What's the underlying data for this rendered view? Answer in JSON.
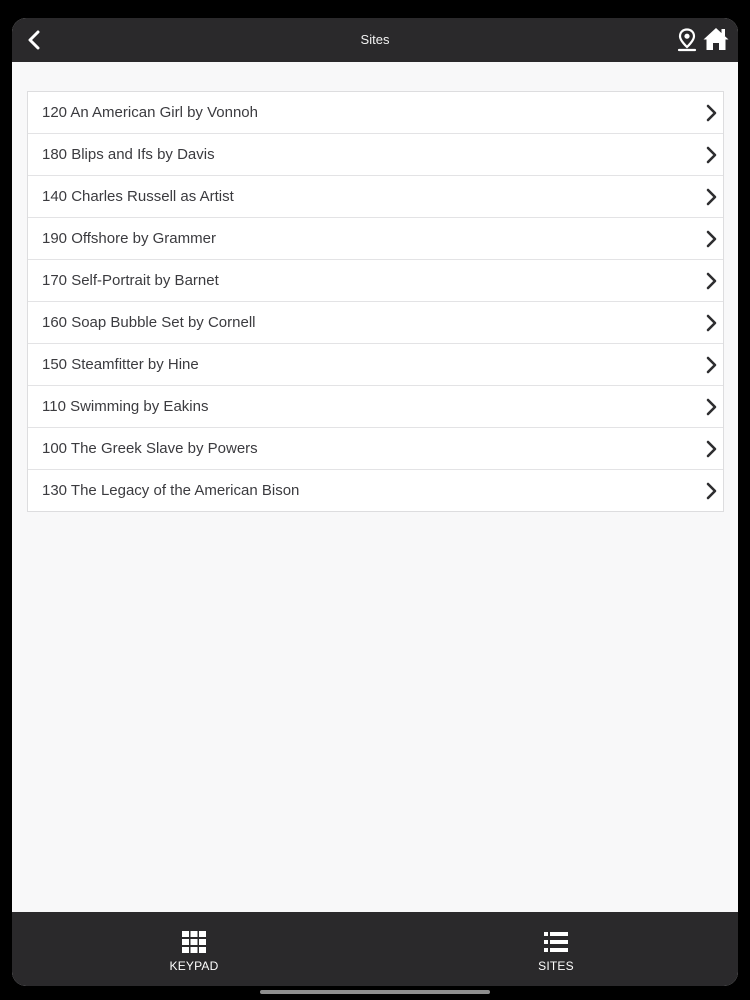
{
  "header": {
    "title": "Sites"
  },
  "sites": [
    {
      "label": "120 An American Girl by Vonnoh"
    },
    {
      "label": "180 Blips and Ifs by Davis"
    },
    {
      "label": "140 Charles Russell as Artist"
    },
    {
      "label": "190 Offshore by Grammer"
    },
    {
      "label": "170 Self-Portrait by Barnet"
    },
    {
      "label": "160 Soap Bubble Set by Cornell"
    },
    {
      "label": "150 Steamfitter by Hine"
    },
    {
      "label": "110 Swimming by Eakins"
    },
    {
      "label": "100 The Greek Slave by Powers"
    },
    {
      "label": "130 The Legacy of the American Bison"
    }
  ],
  "tabs": {
    "keypad_label": "KEYPAD",
    "sites_label": "SITES"
  },
  "icons": {
    "back": "chevron-left-icon",
    "location": "map-pin-icon",
    "home": "home-icon",
    "row": "chevron-right-icon",
    "keypad": "grid-icon",
    "sites": "list-icon"
  }
}
